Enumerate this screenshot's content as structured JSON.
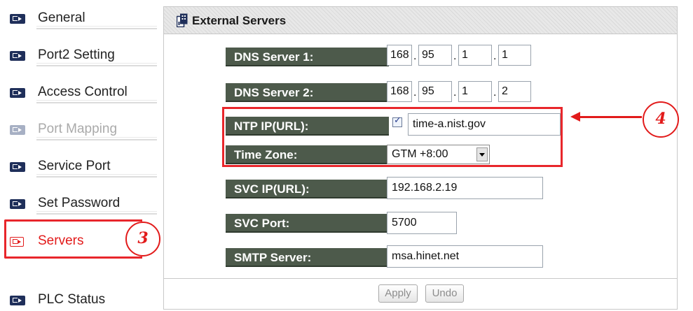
{
  "sidebar": {
    "items": [
      {
        "label": "General",
        "state": "normal"
      },
      {
        "label": "Port2 Setting",
        "state": "normal"
      },
      {
        "label": "Access Control",
        "state": "normal"
      },
      {
        "label": "Port Mapping",
        "state": "disabled"
      },
      {
        "label": "Service Port",
        "state": "normal"
      },
      {
        "label": "Set Password",
        "state": "normal"
      },
      {
        "label": "Servers",
        "state": "active"
      },
      {
        "label": "PLC Status",
        "state": "normal"
      }
    ]
  },
  "annotations": {
    "callout_3": "3",
    "callout_4": "4",
    "highlight_color": "#e8262b"
  },
  "panel": {
    "title": "External Servers",
    "icon": "server-icon",
    "fields": {
      "dns1": {
        "label": "DNS Server 1:",
        "octets": [
          "168",
          "95",
          "1",
          "1"
        ]
      },
      "dns2": {
        "label": "DNS Server 2:",
        "octets": [
          "168",
          "95",
          "1",
          "2"
        ]
      },
      "ntp": {
        "label": "NTP IP(URL):",
        "checked": true,
        "value": "time-a.nist.gov"
      },
      "timezone": {
        "label": "Time Zone:",
        "value": "GTM +8:00"
      },
      "svc_ip": {
        "label": "SVC IP(URL):",
        "value": "192.168.2.19"
      },
      "svc_port": {
        "label": "SVC Port:",
        "value": "5700"
      },
      "smtp": {
        "label": "SMTP Server:",
        "value": "msa.hinet.net"
      }
    },
    "buttons": {
      "apply": "Apply",
      "undo": "Undo"
    }
  },
  "colors": {
    "label_bg": "#4d5a4b",
    "active_red": "#e21b1b",
    "icon_navy": "#1f2f5a"
  }
}
